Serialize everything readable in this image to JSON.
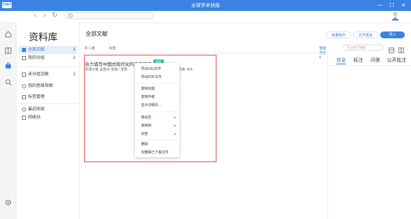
{
  "window": {
    "title": "全球学术快报",
    "logo_text": "CNKI",
    "minimize_glyph": "—",
    "maximize_glyph": "☐",
    "close_glyph": "✕"
  },
  "toolbar": {
    "back_glyph": "‹",
    "forward_glyph": "›",
    "refresh_glyph": "↻"
  },
  "rail": {
    "icons": [
      "home-icon",
      "book-icon",
      "briefcase-icon",
      "search-icon",
      "settings-icon"
    ],
    "active_color": "#3a83e2"
  },
  "sidebar": {
    "title": "资料库",
    "items": [
      {
        "label": "全部文献",
        "count": "1",
        "active": true
      },
      {
        "label": "我的分组",
        "count": "1"
      },
      {
        "label": "未分组文献",
        "count": "1"
      },
      {
        "label": "我的思维导图",
        "count": ""
      },
      {
        "label": "标签管理",
        "count": ""
      },
      {
        "label": "最近阅读",
        "count": ""
      },
      {
        "label": "回收站",
        "count": ""
      }
    ]
  },
  "main": {
    "title": "全部文献",
    "count_text": "共 1 篇",
    "tag_label": "标签:",
    "sort_label": "智能排序 ▾",
    "search_placeholder": "在分组下搜索"
  },
  "actions": {
    "batch": "批量操作",
    "open_more": "打开更多",
    "import": "导入"
  },
  "document": {
    "title": "合力谱写中国式现代化的天津篇章",
    "badge": "报纸",
    "meta": "本报记者 孟若冰 张雨 / 发表",
    "read": "阅读: N/A"
  },
  "context_menu": {
    "items": [
      {
        "label": "导出CAJ文件"
      },
      {
        "label": "导出PDF文件"
      },
      {
        "label": "复制标题"
      },
      {
        "label": "复制作者"
      },
      {
        "label": "显示详细页..."
      },
      {
        "label": "移动至",
        "arrow": "▸"
      },
      {
        "label": "复制到",
        "arrow": "▸"
      },
      {
        "label": "标签",
        "arrow": "▸"
      },
      {
        "label": "删除"
      },
      {
        "label": "仅删除已下载文件"
      }
    ]
  },
  "right_panel": {
    "tabs": [
      "信息",
      "标注",
      "问答",
      "公开批注"
    ]
  },
  "colors": {
    "brand": "#3a83e2",
    "highlight": "#e04c4c",
    "badge": "#2db3a6"
  }
}
